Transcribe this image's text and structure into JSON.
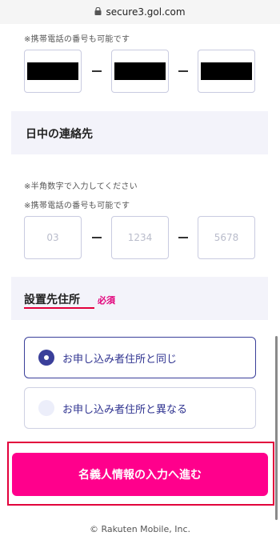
{
  "browser": {
    "url": "secure3.gol.com"
  },
  "notes": {
    "mobile_ok_top": "※携帯電話の番号も可能です",
    "half_width": "※半角数字で入力してください",
    "mobile_ok_daytime": "※携帯電話の番号も可能です"
  },
  "daytime_contact": {
    "title": "日中の連絡先",
    "placeholders": [
      "03",
      "1234",
      "5678"
    ]
  },
  "install_address": {
    "title": "設置先住所",
    "required": "必須",
    "options": [
      {
        "label": "お申し込み者住所と同じ",
        "selected": true
      },
      {
        "label": "お申し込み者住所と異なる",
        "selected": false
      }
    ]
  },
  "cta": {
    "label": "名義人情報の入力へ進む"
  },
  "footer": {
    "copyright": "© Rakuten Mobile, Inc."
  },
  "colors": {
    "accent": "#ff008c",
    "highlight": "#e2003c",
    "radio": "#3a3f9a"
  }
}
